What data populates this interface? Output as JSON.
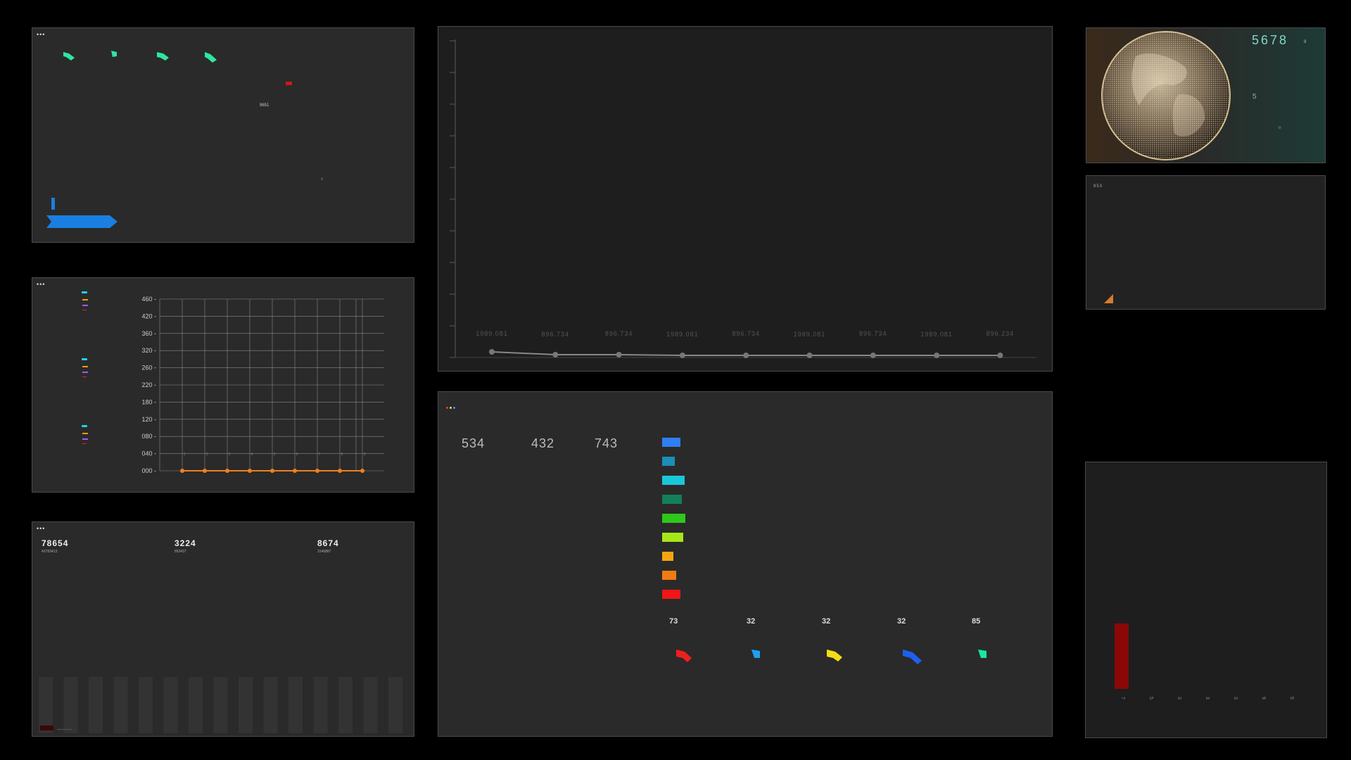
{
  "panel_top_left": {
    "menu_dots": "•••",
    "label_small": "9651",
    "marker": "x"
  },
  "panel_chart": {
    "menu_dots": "•••",
    "y_ticks": [
      "460",
      "420",
      "360",
      "320",
      "260",
      "220",
      "180",
      "120",
      "080",
      "040",
      "000"
    ],
    "point_labels": [
      "1",
      "2",
      "3",
      "4",
      "5",
      "6",
      "7",
      "8",
      "9"
    ]
  },
  "panel_stats": {
    "menu_dots": "•••",
    "stats": [
      {
        "value": "78654",
        "sub": "43783413"
      },
      {
        "value": "3224",
        "sub": "853437"
      },
      {
        "value": "8674",
        "sub": "3146887"
      }
    ]
  },
  "panel_line": {
    "labels": [
      "1989.081",
      "896.734",
      "896.734",
      "1989.081",
      "896.734",
      "1989.081",
      "896.734",
      "1989.081",
      "896.234"
    ]
  },
  "panel_center": {
    "menu_dots": "•••",
    "numbers": [
      "534",
      "432",
      "743"
    ],
    "swatches": [
      "#2f7ff0",
      "#1a8fb8",
      "#19c8d8",
      "#13805a",
      "#2ec81a",
      "#a6e619",
      "#f4a612",
      "#f07c12",
      "#f01616"
    ],
    "gauge_values": [
      "73",
      "32",
      "32",
      "32",
      "85"
    ],
    "gauge_colors": [
      "#f01e1e",
      "#1e9ff0",
      "#f4dc16",
      "#1e5ff0",
      "#19e6a6"
    ]
  },
  "panel_globe": {
    "big_number": "5678",
    "unit": "9",
    "side_value": "5",
    "marker": "o"
  },
  "panel_right_mid": {
    "label": "853"
  },
  "panel_right_bottom": {
    "x_labels": [
      "7",
      "5",
      "3",
      "3",
      "3",
      "9",
      "5"
    ]
  },
  "chart_data": {
    "type": "line",
    "title": "",
    "categories": [
      "1",
      "2",
      "3",
      "4",
      "5",
      "6",
      "7",
      "8",
      "9"
    ],
    "series": [
      {
        "values": [
          0,
          0,
          0,
          0,
          0,
          0,
          0,
          0,
          0
        ]
      }
    ],
    "y_ticks": [
      "460",
      "420",
      "360",
      "320",
      "260",
      "220",
      "180",
      "120",
      "080",
      "040",
      "000"
    ],
    "ylim": [
      0,
      460
    ],
    "grid": true
  }
}
